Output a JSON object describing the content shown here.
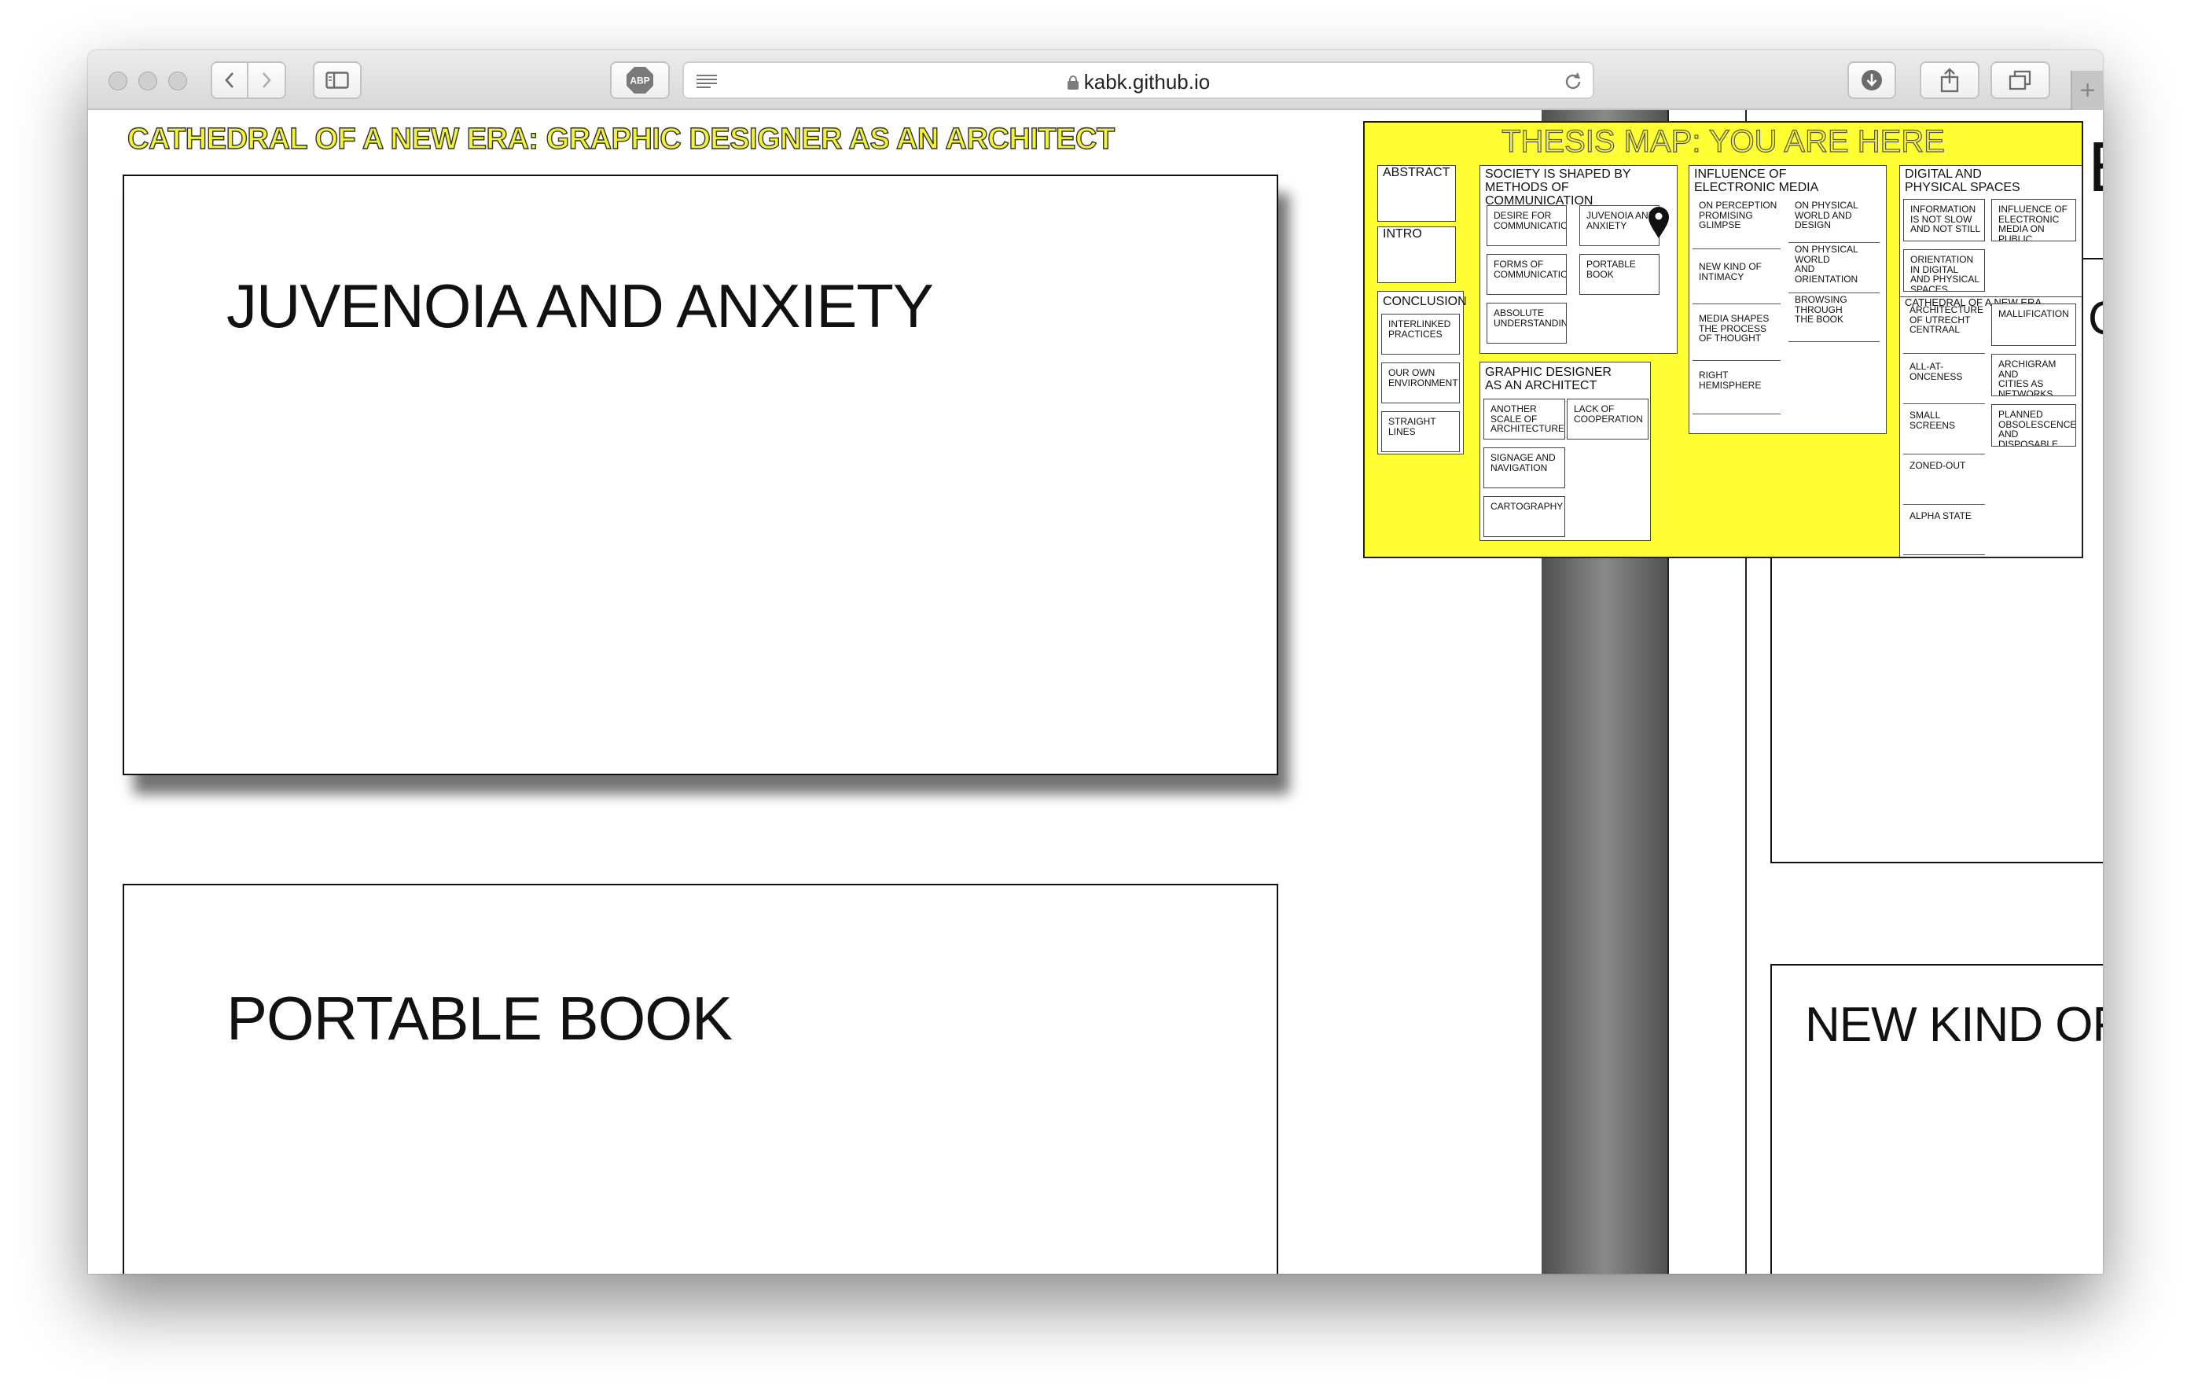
{
  "browser": {
    "url": "kabk.github.io",
    "adblock_label": "ABP",
    "new_tab": "+"
  },
  "page": {
    "site_title": "CATHEDRAL OF A NEW ERA: GRAPHIC DESIGNER AS AN ARCHITECT",
    "cards": [
      {
        "title": "JUVENOIA AND ANXIETY"
      },
      {
        "title": "PORTABLE BOOK"
      }
    ],
    "right_column": {
      "partial_letter_top": "E",
      "partial_letter_mid": "C",
      "card_title": "NEW KIND OF"
    }
  },
  "thesis_map": {
    "title": "THESIS MAP: YOU ARE HERE",
    "abstract": "ABSTRACT",
    "intro": "INTRO",
    "conclusion": {
      "label": "CONCLUSION",
      "items": [
        "INTERLINKED\nPRACTICES",
        "OUR OWN\nENVIRONMENT",
        "STRAIGHT\nLINES"
      ]
    },
    "society": {
      "label": "SOCIETY IS SHAPED BY\nMETHODS OF COMMUNICATION",
      "items": [
        "DESIRE FOR\nCOMMUNICATION",
        "JUVENOIA AND\nANXIETY",
        "FORMS OF\nCOMMUNICATION",
        "PORTABLE\nBOOK",
        "ABSOLUTE\nUNDERSTANDING"
      ]
    },
    "graphic_designer": {
      "label": "GRAPHIC DESIGNER\nAS AN ARCHITECT",
      "items": [
        "ANOTHER\nSCALE OF\nARCHITECTURE",
        "LACK OF\nCOOPERATION",
        "SIGNAGE AND\nNAVIGATION",
        "CARTOGRAPHY"
      ]
    },
    "electronic_media": {
      "label": "INFLUENCE OF\nELECTRONIC MEDIA",
      "col1": [
        "ON PERCEPTION\nPROMISING\nGLIMPSE",
        "NEW KIND OF\nINTIMACY",
        "MEDIA SHAPES\nTHE PROCESS\nOF THOUGHT",
        "RIGHT\nHEMISPHERE"
      ],
      "col2": [
        "ON PHYSICAL\nWORLD AND\nDESIGN",
        "ON PHYSICAL\nWORLD\nAND\nORIENTATION",
        "BROWSING\nTHROUGH\nTHE BOOK"
      ]
    },
    "digital_spaces": {
      "label": "DIGITAL AND\nPHYSICAL SPACES",
      "items": [
        "INFORMATION\nIS NOT SLOW\nAND NOT STILL",
        "INFLUENCE OF\nELECTRONIC\nMEDIA ON\nPUBLIC",
        "ORIENTATION\nIN DIGITAL\nAND PHYSICAL\nSPACES"
      ],
      "cathedral": {
        "label": "CATHEDRAL OF A NEW ERA",
        "col1": [
          "ARCHITECTURE\nOF UTRECHT\nCENTRAAL",
          "ALL-AT-\nONCENESS",
          "SMALL SCREENS",
          "ZONED-OUT",
          "ALPHA STATE"
        ],
        "col2": [
          "MALLIFICATION",
          "ARCHIGRAM AND\nCITIES AS\nNETWORKS\nOF INCIDENCE",
          "PLANNED\nOBSOLESCENCE\nAND\nDISPOSABLE"
        ]
      }
    }
  }
}
